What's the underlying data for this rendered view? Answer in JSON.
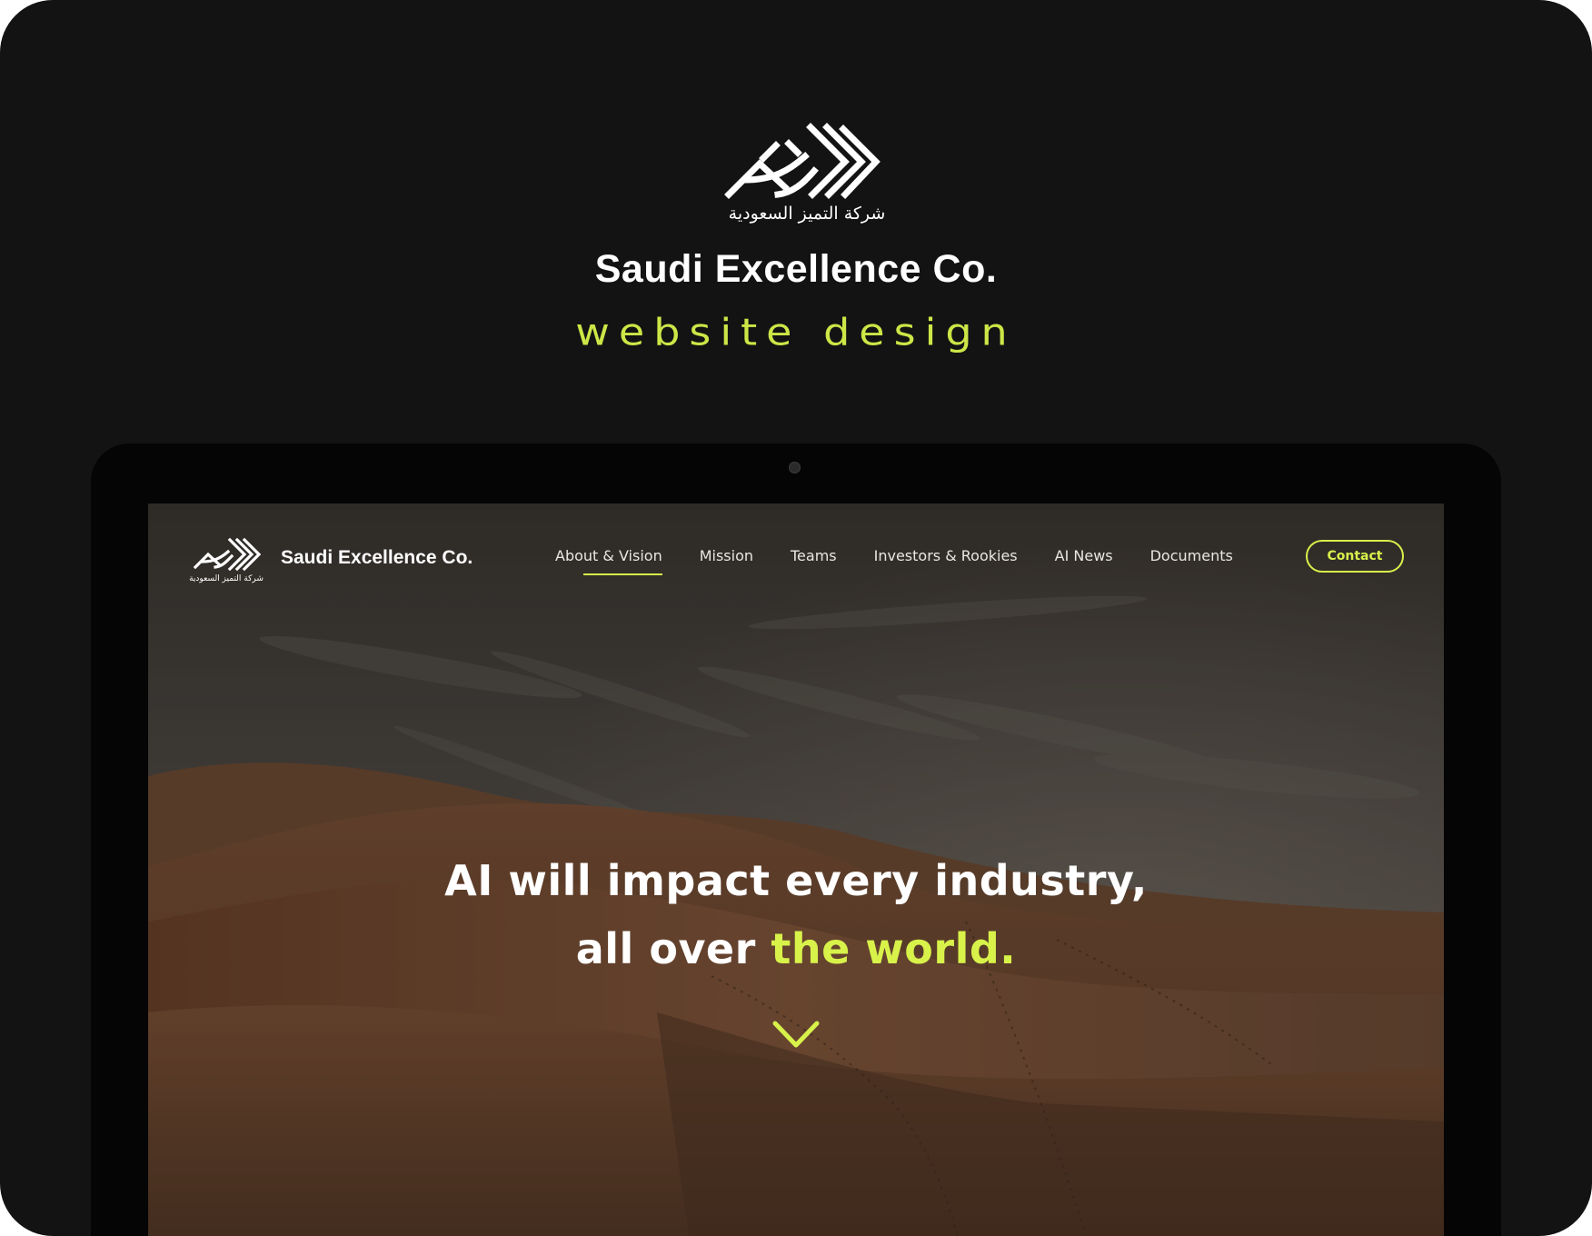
{
  "presentation": {
    "logo_arabic": "شركة التميز السعودية",
    "title": "Saudi Excellence Co.",
    "subtitle": "website design"
  },
  "website": {
    "logo_arabic": "شركة التميز السعودية",
    "brand_name": "Saudi Excellence Co.",
    "nav": [
      {
        "label": "About & Vision",
        "active": true
      },
      {
        "label": "Mission",
        "active": false
      },
      {
        "label": "Teams",
        "active": false
      },
      {
        "label": "Investors & Rookies",
        "active": false
      },
      {
        "label": "AI News",
        "active": false
      },
      {
        "label": "Documents",
        "active": false
      }
    ],
    "contact_label": "Contact",
    "hero": {
      "line1": "AI will impact every industry,",
      "line2_prefix": "all over ",
      "line2_accent": "the world."
    }
  },
  "colors": {
    "background": "#131313",
    "accent": "#d8f24a",
    "laptop_bezel": "#050505",
    "text": "#ffffff"
  },
  "icons": {
    "scroll": "chevron-down-icon",
    "logo": "brand-logo-mark"
  }
}
